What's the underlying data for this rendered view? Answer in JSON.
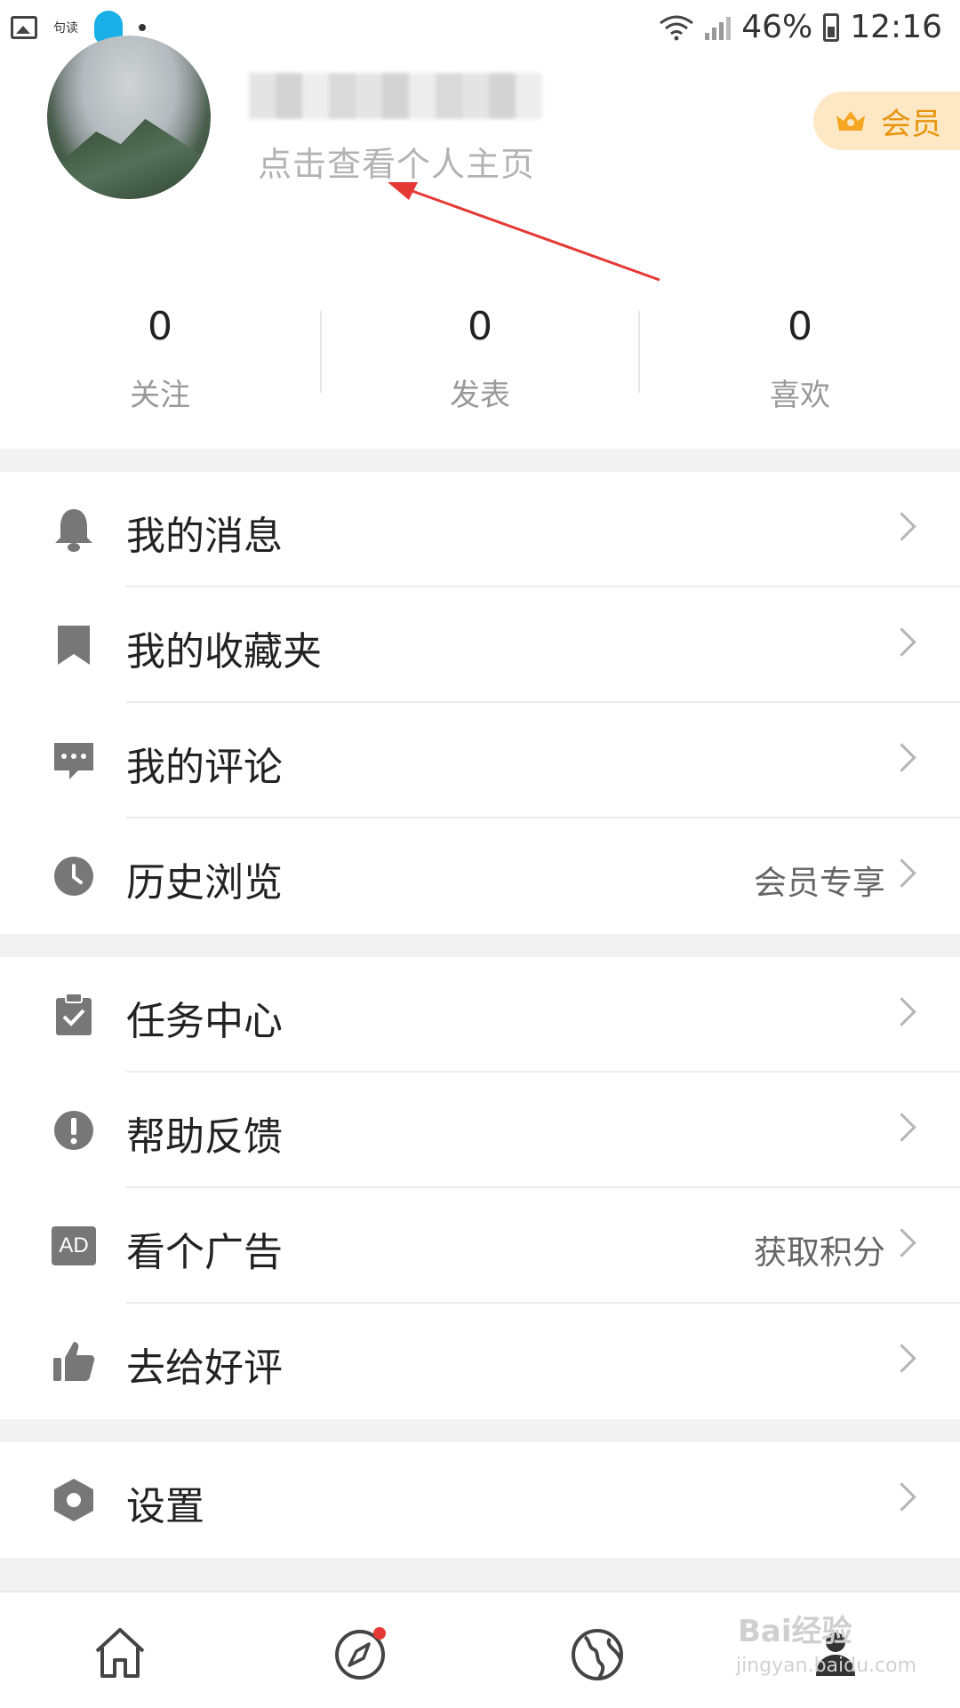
{
  "status_bar": {
    "app_label": "句读",
    "battery": "46%",
    "time": "12:16",
    "icons": [
      "gallery-icon",
      "qq-icon",
      "dot-icon",
      "wifi-icon",
      "signal-icon",
      "battery-icon"
    ]
  },
  "profile": {
    "view_profile_text": "点击查看个人主页",
    "vip_label": "会员",
    "vip_color": "#e8940c"
  },
  "stats": [
    {
      "value": "0",
      "label": "关注"
    },
    {
      "value": "0",
      "label": "发表"
    },
    {
      "value": "0",
      "label": "喜欢"
    }
  ],
  "menu": {
    "group1": [
      {
        "label": "我的消息",
        "icon": "bell-icon"
      },
      {
        "label": "我的收藏夹",
        "icon": "bookmark-icon"
      },
      {
        "label": "我的评论",
        "icon": "comment-icon"
      },
      {
        "label": "历史浏览",
        "icon": "clock-icon",
        "extra": "会员专享"
      }
    ],
    "group2": [
      {
        "label": "任务中心",
        "icon": "clipboard-check-icon"
      },
      {
        "label": "帮助反馈",
        "icon": "exclamation-icon"
      },
      {
        "label": "看个广告",
        "icon": "ad-icon",
        "icon_text": "AD",
        "extra": "获取积分"
      },
      {
        "label": "去给好评",
        "icon": "thumbs-up-icon"
      }
    ],
    "group3": [
      {
        "label": "设置",
        "icon": "settings-hexagon-icon"
      }
    ]
  },
  "bottom_nav": {
    "tabs": [
      "home-icon",
      "compass-icon",
      "globe-icon",
      "profile-icon"
    ],
    "badge_color": "#e53935"
  },
  "watermark": {
    "main": "Bai经验",
    "sub": "jingyan.baidu.com"
  },
  "colors": {
    "accent_arrow": "#e53935",
    "section_gap": "#f2f2f2",
    "icon_gray": "#777777"
  }
}
